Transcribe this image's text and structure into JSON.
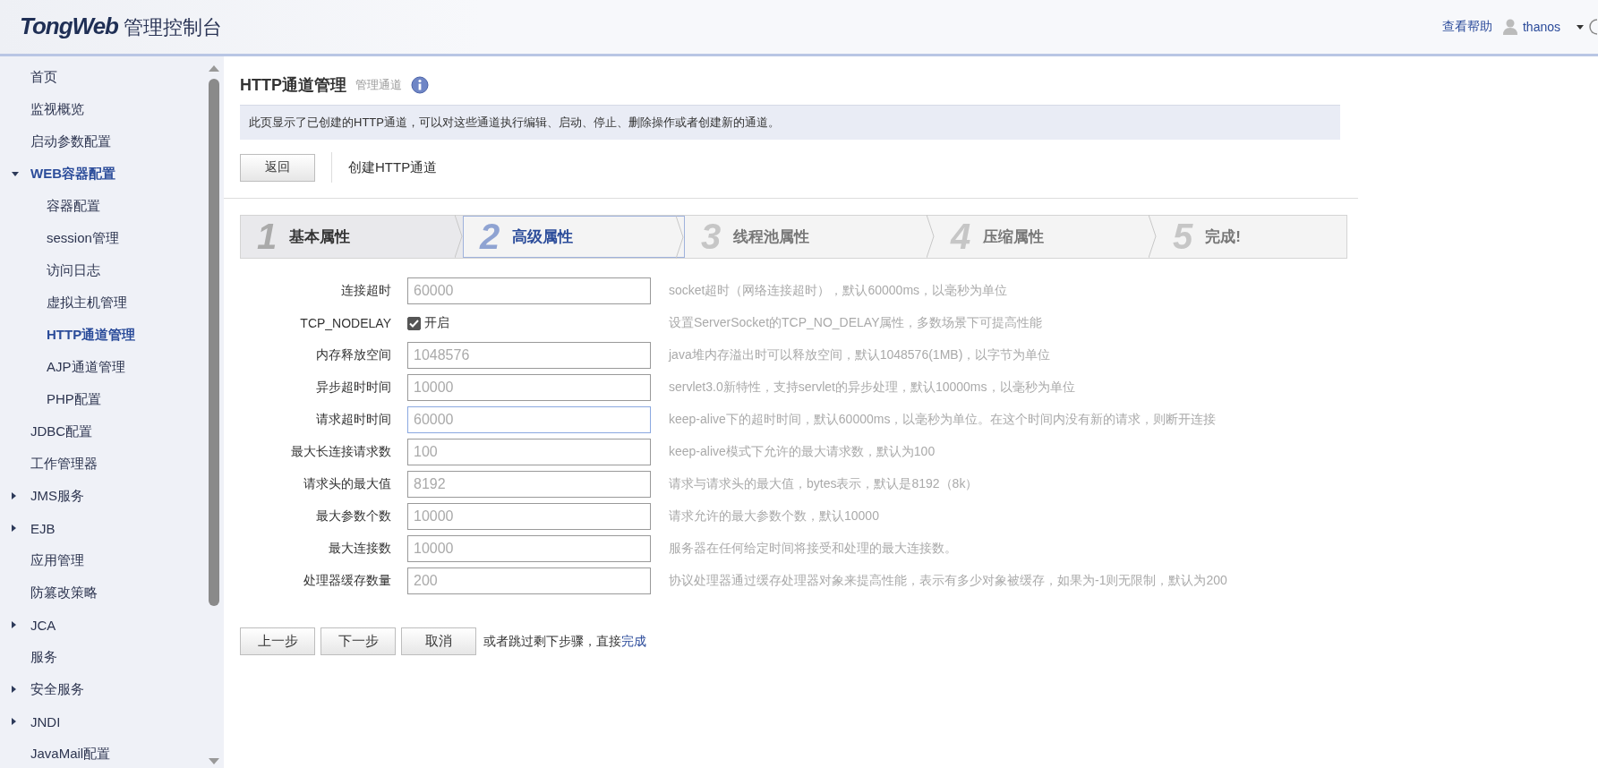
{
  "header": {
    "logo_brand": "TongWeb",
    "logo_title": "管理控制台",
    "help_link": "查看帮助",
    "user": "thanos"
  },
  "sidebar": {
    "items": [
      {
        "label": "首页",
        "selected": false
      },
      {
        "label": "监视概览",
        "selected": false
      },
      {
        "label": "启动参数配置",
        "selected": false
      },
      {
        "label": "WEB容器配置",
        "selected": true,
        "expanded": true,
        "children": [
          {
            "label": "容器配置",
            "selected": false
          },
          {
            "label": "session管理",
            "selected": false
          },
          {
            "label": "访问日志",
            "selected": false
          },
          {
            "label": "虚拟主机管理",
            "selected": false
          },
          {
            "label": "HTTP通道管理",
            "selected": true
          },
          {
            "label": "AJP通道管理",
            "selected": false
          },
          {
            "label": "PHP配置",
            "selected": false
          }
        ]
      },
      {
        "label": "JDBC配置",
        "selected": false
      },
      {
        "label": "工作管理器",
        "selected": false
      },
      {
        "label": "JMS服务",
        "selected": false,
        "expanded": false
      },
      {
        "label": "EJB",
        "selected": false,
        "expanded": false
      },
      {
        "label": "应用管理",
        "selected": false
      },
      {
        "label": "防篡改策略",
        "selected": false
      },
      {
        "label": "JCA",
        "selected": false,
        "expanded": false
      },
      {
        "label": "服务",
        "selected": false
      },
      {
        "label": "安全服务",
        "selected": false,
        "expanded": false
      },
      {
        "label": "JNDI",
        "selected": false,
        "expanded": false
      },
      {
        "label": "JavaMail配置",
        "selected": false
      }
    ]
  },
  "page": {
    "title": "HTTP通道管理",
    "subtitle": "管理通道",
    "description": "此页显示了已创建的HTTP通道，可以对这些通道执行编辑、启动、停止、删除操作或者创建新的通道。",
    "back_button": "返回",
    "section_title": "创建HTTP通道"
  },
  "steps": [
    {
      "number": "1",
      "label": "基本属性",
      "selected": false,
      "completed": true
    },
    {
      "number": "2",
      "label": "高级属性",
      "selected": true,
      "completed": false
    },
    {
      "number": "3",
      "label": "线程池属性",
      "selected": false,
      "completed": false
    },
    {
      "number": "4",
      "label": "压缩属性",
      "selected": false,
      "completed": false
    },
    {
      "number": "5",
      "label": "完成!",
      "selected": false,
      "completed": false
    }
  ],
  "form": [
    {
      "kind": "text",
      "label": "连接超时",
      "value": "60000",
      "focused": false,
      "hint": "socket超时（网络连接超时），默认60000ms，以毫秒为单位"
    },
    {
      "kind": "checkbox",
      "label": "TCP_NODELAY",
      "checked": true,
      "option": "开启",
      "hint": "设置ServerSocket的TCP_NO_DELAY属性，多数场景下可提高性能"
    },
    {
      "kind": "text",
      "label": "内存释放空间",
      "value": "1048576",
      "focused": false,
      "hint": "java堆内存溢出时可以释放空间，默认1048576(1MB)，以字节为单位"
    },
    {
      "kind": "text",
      "label": "异步超时时间",
      "value": "10000",
      "focused": false,
      "hint": "servlet3.0新特性，支持servlet的异步处理，默认10000ms，以毫秒为单位"
    },
    {
      "kind": "text",
      "label": "请求超时时间",
      "value": "60000",
      "focused": true,
      "hint": "keep-alive下的超时时间，默认60000ms，以毫秒为单位。在这个时间内没有新的请求，则断开连接"
    },
    {
      "kind": "text",
      "label": "最大长连接请求数",
      "value": "100",
      "focused": false,
      "hint": "keep-alive模式下允许的最大请求数，默认为100"
    },
    {
      "kind": "text",
      "label": "请求头的最大值",
      "value": "8192",
      "focused": false,
      "hint": "请求与请求头的最大值，bytes表示，默认是8192（8k）"
    },
    {
      "kind": "text",
      "label": "最大参数个数",
      "value": "10000",
      "focused": false,
      "hint": "请求允许的最大参数个数，默认10000"
    },
    {
      "kind": "text",
      "label": "最大连接数",
      "value": "10000",
      "focused": false,
      "hint": "服务器在任何给定时间将接受和处理的最大连接数。"
    },
    {
      "kind": "text",
      "label": "处理器缓存数量",
      "value": "200",
      "focused": false,
      "hint": "协议处理器通过缓存处理器对象来提高性能，表示有多少对象被缓存，如果为-1则无限制，默认为200"
    }
  ],
  "actions": {
    "buttons": [
      "上一步",
      "下一步",
      "取消"
    ],
    "skip_text": "或者跳过剩下步骤，直接",
    "skip_link": "完成"
  }
}
